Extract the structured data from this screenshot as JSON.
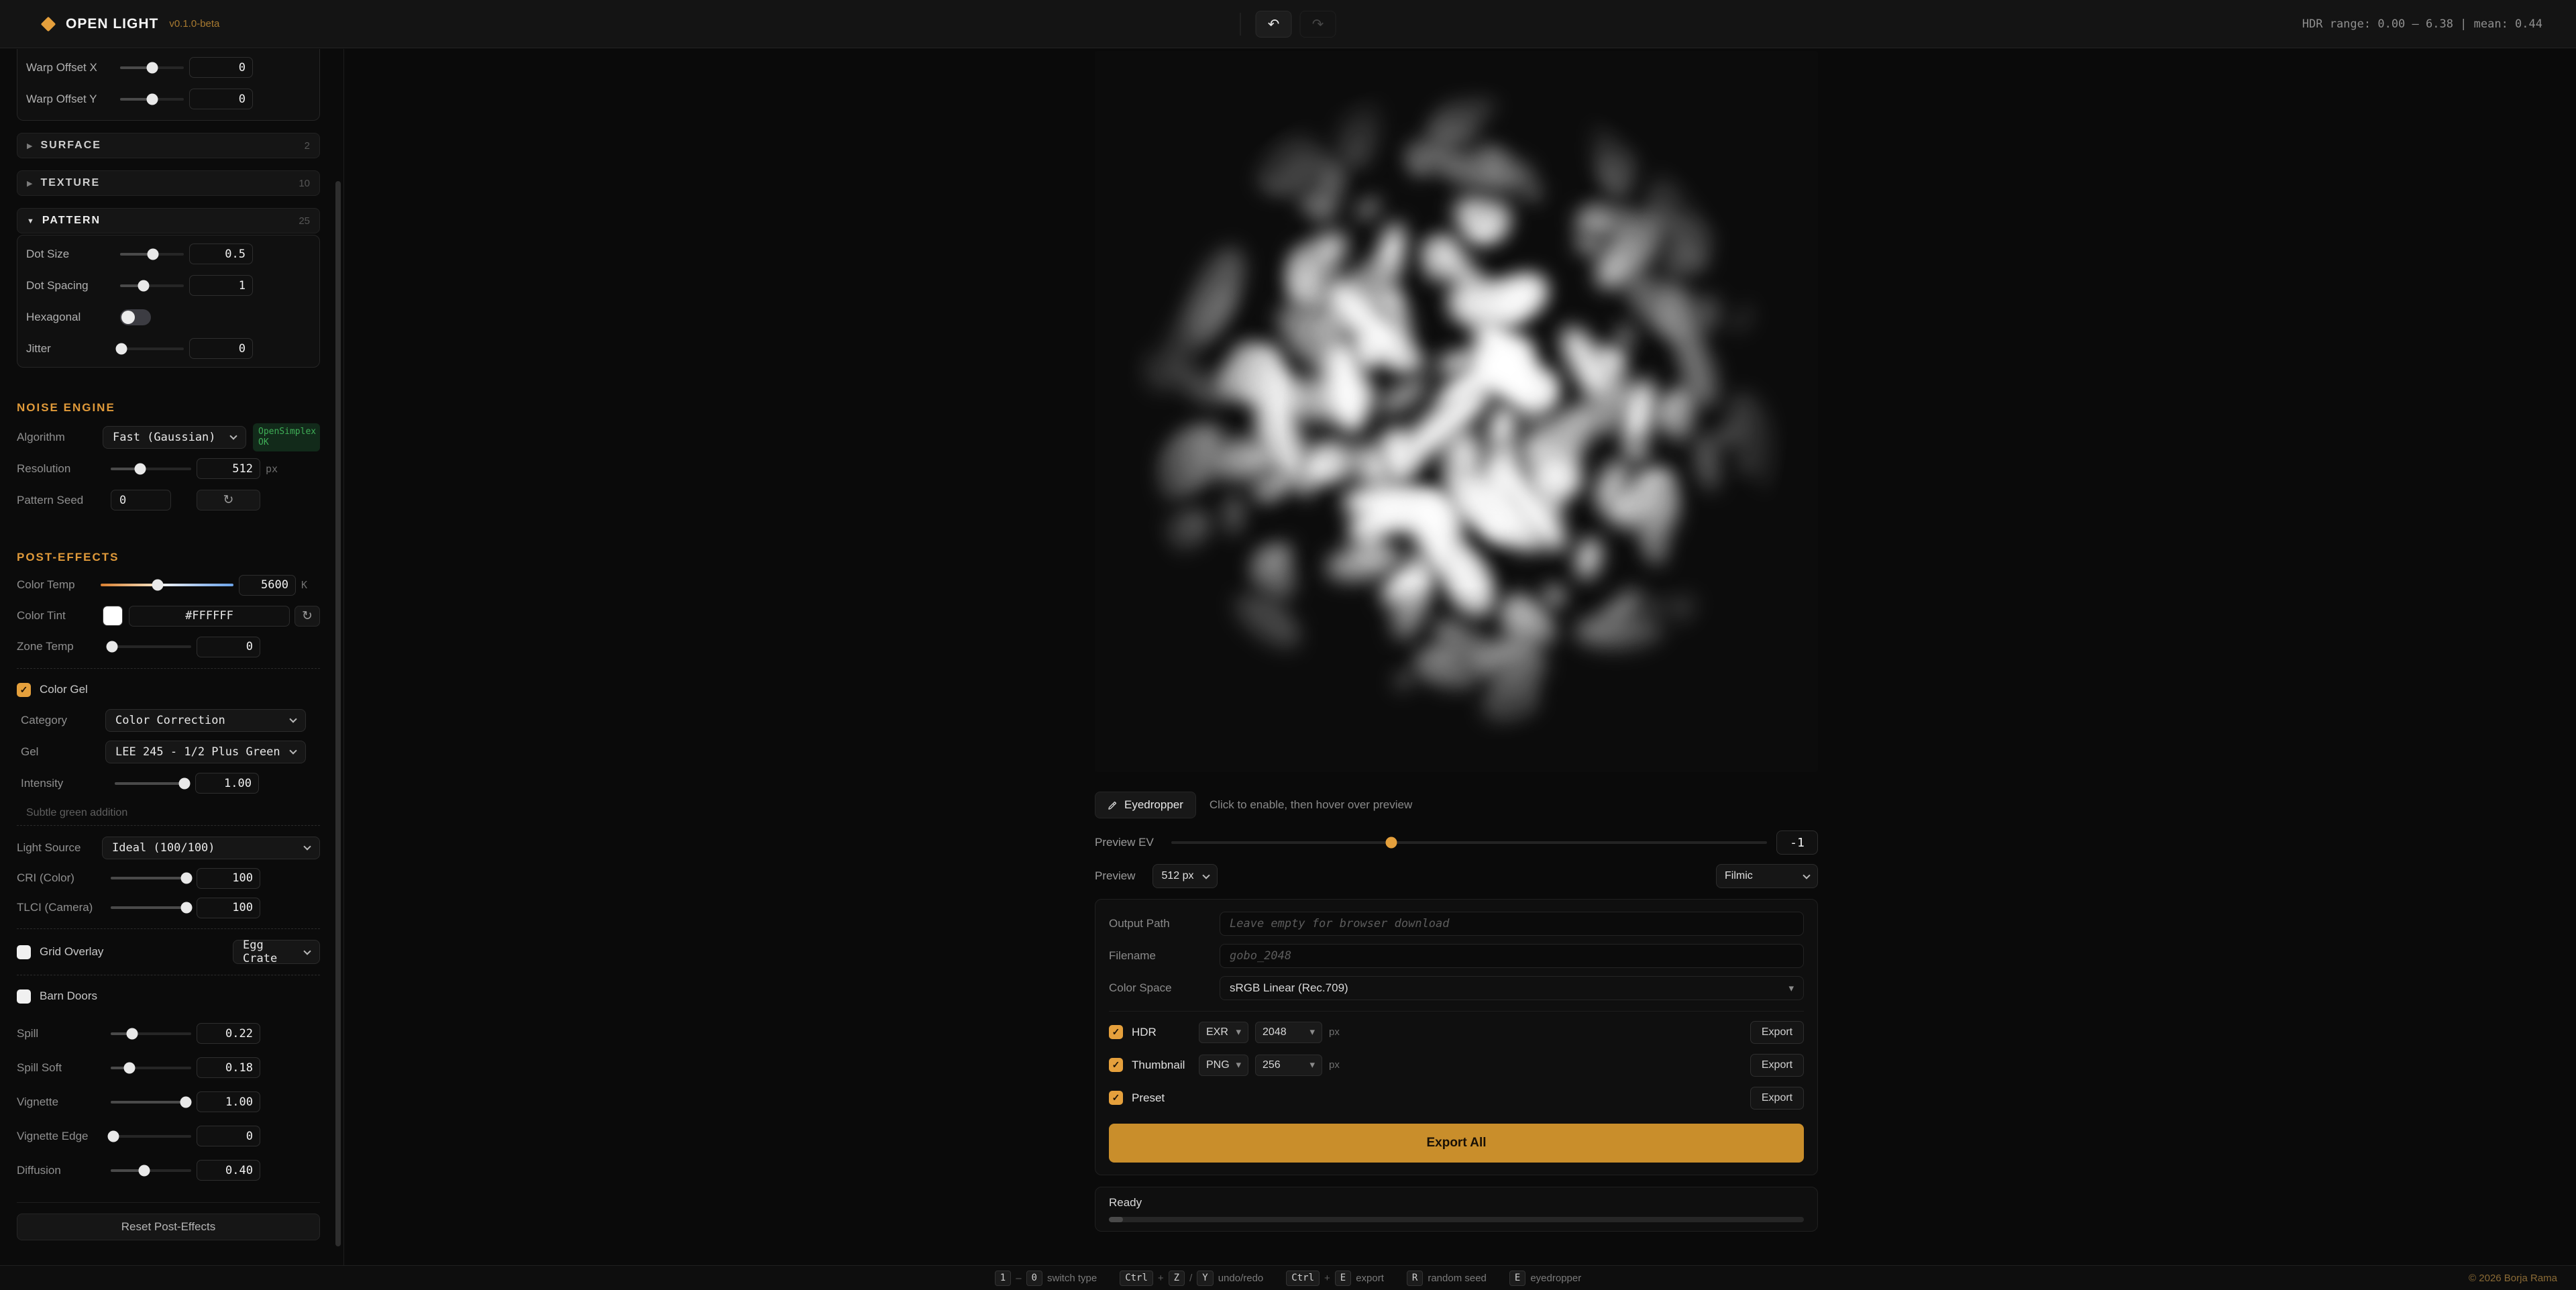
{
  "colors": {
    "accent": "#E5A03C",
    "success_green": "#3FAE57",
    "export_all_bg": "#C98E2B"
  },
  "header": {
    "app_title": "OPEN LIGHT",
    "version": "v0.1.0-beta",
    "hdr_stats": "HDR range: 0.00 – 6.38 | mean: 0.44"
  },
  "sidebar": {
    "warp_offset_x": {
      "label": "Warp Offset X",
      "value": "0",
      "pct": 50
    },
    "warp_offset_y": {
      "label": "Warp Offset Y",
      "value": "0",
      "pct": 50
    },
    "sections": {
      "surface": {
        "label": "SURFACE",
        "count": "2"
      },
      "texture": {
        "label": "TEXTURE",
        "count": "10"
      },
      "pattern": {
        "label": "PATTERN",
        "count": "25"
      }
    },
    "pattern": {
      "dot_size": {
        "label": "Dot Size",
        "value": "0.5",
        "pct": 52
      },
      "dot_spacing": {
        "label": "Dot Spacing",
        "value": "1",
        "pct": 37
      },
      "hexagonal": {
        "label": "Hexagonal",
        "on": false
      },
      "jitter": {
        "label": "Jitter",
        "value": "0",
        "pct": 2
      }
    },
    "noise_engine": {
      "title": "NOISE ENGINE",
      "algorithm": {
        "label": "Algorithm",
        "value": "Fast (Gaussian)",
        "badge_line1": "OpenSimplex",
        "badge_line2": "OK"
      },
      "resolution": {
        "label": "Resolution",
        "value": "512",
        "unit": "px",
        "pct": 37
      },
      "pattern_seed": {
        "label": "Pattern Seed",
        "value": "0"
      }
    },
    "post_effects": {
      "title": "POST-EFFECTS",
      "color_temp": {
        "label": "Color Temp",
        "value": "5600",
        "unit": "K",
        "pct": 43
      },
      "color_tint": {
        "label": "Color Tint",
        "value": "#FFFFFF"
      },
      "zone_temp": {
        "label": "Zone Temp",
        "value": "0",
        "pct": 2
      },
      "color_gel": {
        "label": "Color Gel",
        "checked": true
      },
      "category": {
        "label": "Category",
        "value": "Color Correction"
      },
      "gel": {
        "label": "Gel",
        "value": "LEE 245 - 1/2 Plus Green"
      },
      "intensity": {
        "label": "Intensity",
        "value": "1.00",
        "pct": 93
      },
      "gel_note": "Subtle green addition",
      "light_source": {
        "label": "Light Source",
        "value": "Ideal (100/100)"
      },
      "cri": {
        "label": "CRI (Color)",
        "value": "100",
        "pct": 94
      },
      "tlci": {
        "label": "TLCI (Camera)",
        "value": "100",
        "pct": 94
      },
      "grid_overlay": {
        "label": "Grid Overlay",
        "checked": false,
        "value": "Egg Crate"
      },
      "barn_doors": {
        "label": "Barn Doors",
        "checked": false
      },
      "spill": {
        "label": "Spill",
        "value": "0.22",
        "pct": 27
      },
      "spill_soft": {
        "label": "Spill Soft",
        "value": "0.18",
        "pct": 23
      },
      "vignette": {
        "label": "Vignette",
        "value": "1.00",
        "pct": 93
      },
      "vignette_edge": {
        "label": "Vignette Edge",
        "value": "0",
        "pct": 3
      },
      "diffusion": {
        "label": "Diffusion",
        "value": "0.40",
        "pct": 42
      },
      "reset_label": "Reset Post-Effects"
    }
  },
  "preview": {
    "eyedropper_label": "Eyedropper",
    "eyedropper_hint": "Click to enable, then hover over preview",
    "ev": {
      "label": "Preview EV",
      "value": "-1",
      "pct": 37
    },
    "size": {
      "label": "Preview",
      "value": "512 px"
    },
    "tonemap": "Filmic"
  },
  "export": {
    "output_path": {
      "label": "Output Path",
      "placeholder": "Leave empty for browser download"
    },
    "filename": {
      "label": "Filename",
      "placeholder": "gobo_2048"
    },
    "color_space": {
      "label": "Color Space",
      "value": "sRGB Linear (Rec.709)"
    },
    "rows": [
      {
        "label": "HDR",
        "checked": true,
        "format": "EXR",
        "size": "2048",
        "unit": "px",
        "action": "Export"
      },
      {
        "label": "Thumbnail",
        "checked": true,
        "format": "PNG",
        "size": "256",
        "unit": "px",
        "action": "Export"
      },
      {
        "label": "Preset",
        "checked": true,
        "action": "Export"
      }
    ],
    "export_all_label": "Export All"
  },
  "status": {
    "text": "Ready",
    "progress_pct": 2
  },
  "footer": {
    "sep_dash": "–",
    "sep_plus": "+",
    "sep_slash": "/",
    "shortcuts": {
      "switch": {
        "k1": "1",
        "k2": "0",
        "label": "switch type"
      },
      "undo": {
        "k1": "Ctrl",
        "k2": "Z",
        "k3": "Y",
        "label": "undo/redo"
      },
      "export": {
        "k1": "Ctrl",
        "k2": "E",
        "label": "export"
      },
      "seed": {
        "k1": "R",
        "label": "random seed"
      },
      "eyedropper": {
        "k1": "E",
        "label": "eyedropper"
      }
    },
    "copyright": "© 2026 Borja Rama"
  }
}
